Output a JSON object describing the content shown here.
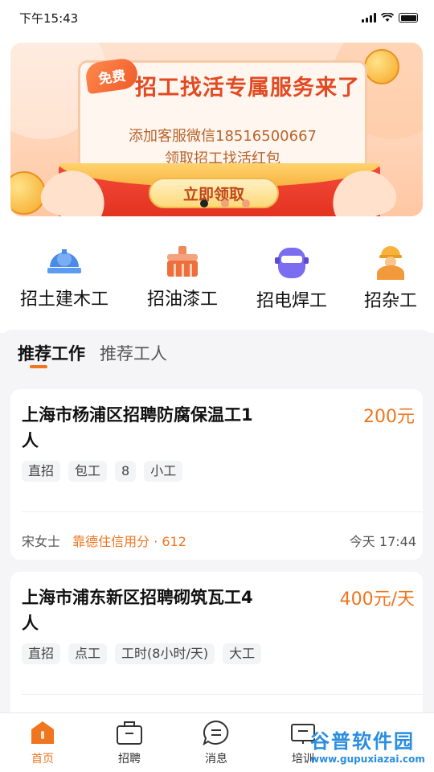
{
  "status": {
    "time": "下午15:43"
  },
  "banner": {
    "badge": "免费",
    "title": "招工找活专属服务来了",
    "line1": "添加客服微信18516500667",
    "line2": "领取招工找活红包",
    "button": "立即领取",
    "page_count": 3,
    "active_page": 1
  },
  "categories": [
    {
      "label": "招土建木工",
      "icon": "hardhat-gear-icon"
    },
    {
      "label": "招油漆工",
      "icon": "paint-brush-icon"
    },
    {
      "label": "招电焊工",
      "icon": "welding-mask-icon"
    },
    {
      "label": "招杂工",
      "icon": "worker-icon"
    }
  ],
  "feed_tabs": [
    {
      "label": "推荐工作",
      "active": true
    },
    {
      "label": "推荐工人",
      "active": false
    }
  ],
  "jobs": [
    {
      "title": "上海市杨浦区招聘防腐保温工1人",
      "price": "200元",
      "tags": [
        "直招",
        "包工",
        "8",
        "小工"
      ],
      "poster": "宋女士",
      "credit": "靠德住信用分 · 612",
      "time": "今天 17:44"
    },
    {
      "title": "上海市浦东新区招聘砌筑瓦工4人",
      "price": "400元/天",
      "tags": [
        "直招",
        "点工",
        "工时(8小时/天)",
        "大工"
      ]
    }
  ],
  "tabbar": [
    {
      "label": "首页",
      "icon": "home-icon",
      "active": true
    },
    {
      "label": "招聘",
      "icon": "briefcase-icon",
      "active": false
    },
    {
      "label": "消息",
      "icon": "message-icon",
      "active": false
    },
    {
      "label": "培训",
      "icon": "training-icon",
      "active": false
    }
  ],
  "watermark": {
    "text": "谷普软件园",
    "url": "www.gupuxiazai.com"
  },
  "colors": {
    "accent": "#f0751f",
    "banner_title": "#e24a22"
  }
}
